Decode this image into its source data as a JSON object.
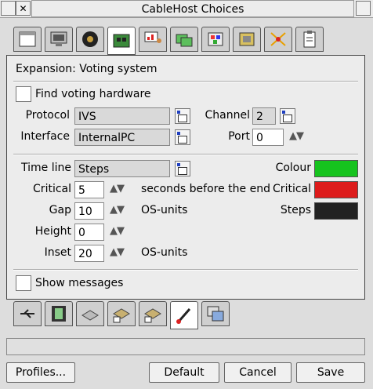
{
  "window": {
    "title": "CableHost Choices"
  },
  "tabs_top": [
    "window-icon",
    "monitor-icon",
    "speaker-icon",
    "circuit-board-icon",
    "presentation-icon",
    "folders-icon",
    "paint-icon",
    "printer-card-icon",
    "network-icon",
    "clipboard-icon"
  ],
  "tabs_bottom": [
    "usb-icon",
    "film-icon",
    "printer-icon",
    "printer-1-icon",
    "printer-2-icon",
    "brush-icon",
    "windows-stack-icon"
  ],
  "panel": {
    "heading": "Expansion: Voting system",
    "find_label": "Find voting hardware",
    "protocol_label": "Protocol",
    "protocol_value": "IVS",
    "interface_label": "Interface",
    "interface_value": "InternalPC",
    "channel_label": "Channel",
    "channel_value": "2",
    "port_label": "Port",
    "port_value": "0",
    "timeline_label": "Time line",
    "timeline_value": "Steps",
    "critical_label": "Critical",
    "critical_value": "5",
    "critical_unit": "seconds before the end",
    "gap_label": "Gap",
    "gap_value": "10",
    "gap_unit": "OS-units",
    "height_label": "Height",
    "height_value": "0",
    "inset_label": "Inset",
    "inset_value": "20",
    "inset_unit": "OS-units",
    "colour_label": "Colour",
    "colour_critical_label": "Critical",
    "colour_steps_label": "Steps",
    "colors": {
      "colour": "#16c31e",
      "critical": "#dd1b1b",
      "steps": "#222222"
    },
    "show_messages_label": "Show messages"
  },
  "buttons": {
    "profiles": "Profiles...",
    "default": "Default",
    "cancel": "Cancel",
    "save": "Save"
  }
}
